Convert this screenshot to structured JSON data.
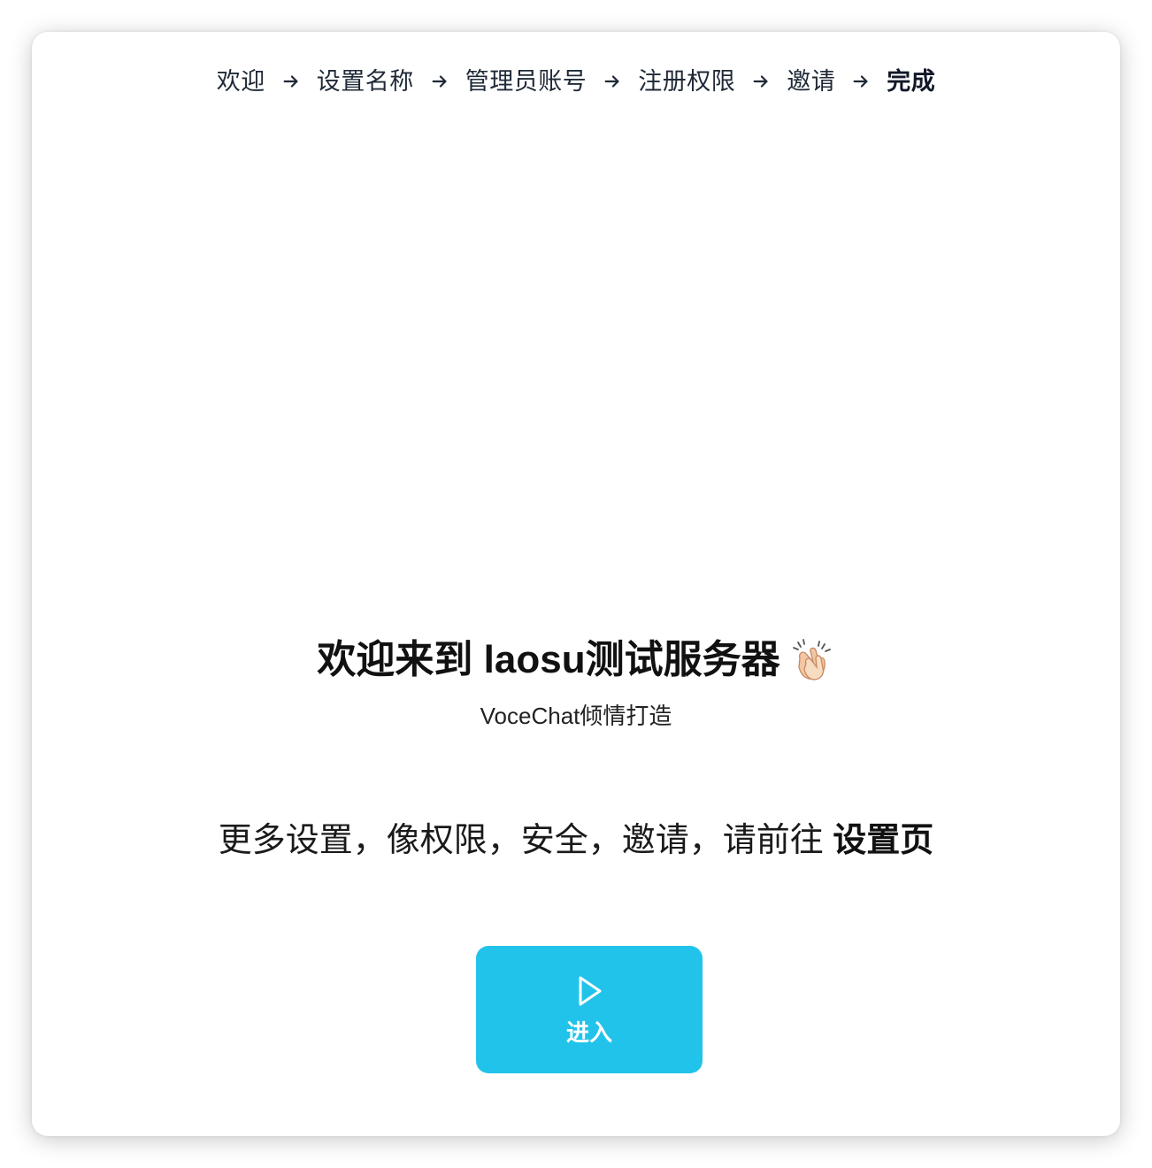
{
  "steps": [
    {
      "label": "欢迎",
      "active": false
    },
    {
      "label": "设置名称",
      "active": false
    },
    {
      "label": "管理员账号",
      "active": false
    },
    {
      "label": "注册权限",
      "active": false
    },
    {
      "label": "邀请",
      "active": false
    },
    {
      "label": "完成",
      "active": true
    }
  ],
  "step_separator_icon": "arrow-right-icon",
  "welcome": {
    "title": "欢迎来到 laosu测试服务器",
    "title_icon": "clapping-hands-icon",
    "subtitle": "VoceChat倾情打造"
  },
  "more_settings": {
    "text": "更多设置，像权限，安全，邀请，请前往 ",
    "link_label": "设置页"
  },
  "enter_button": {
    "icon": "play-icon",
    "label": "进入",
    "color": "#22c3ea"
  }
}
